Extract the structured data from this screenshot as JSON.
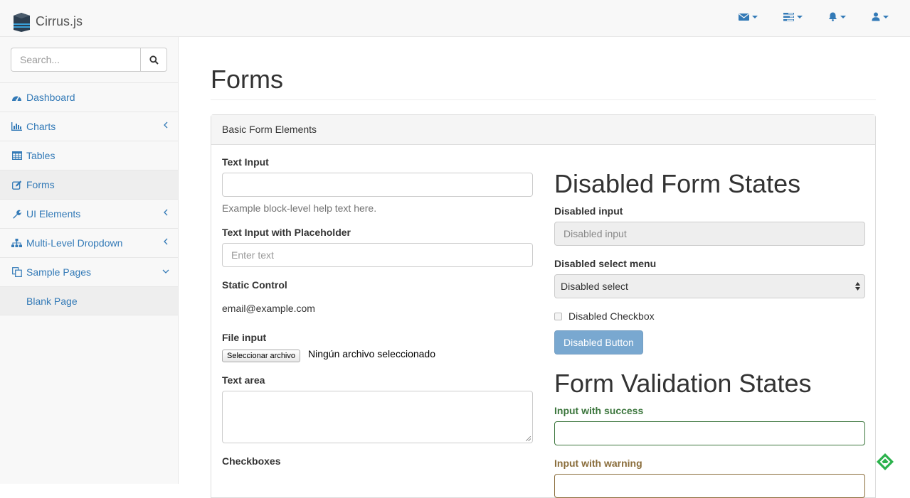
{
  "brand": {
    "name": "Cirrus.js",
    "logo_icon": "cube-logo-icon"
  },
  "navbar": {
    "items": [
      {
        "icon": "envelope-icon"
      },
      {
        "icon": "tasks-icon"
      },
      {
        "icon": "bell-icon"
      },
      {
        "icon": "user-icon"
      }
    ],
    "accent": "#337ab7"
  },
  "sidebar": {
    "search_placeholder": "Search...",
    "items": [
      {
        "label": "Dashboard",
        "icon": "dashboard-icon"
      },
      {
        "label": "Charts",
        "icon": "bar-chart-icon",
        "arrow": "chevron-left"
      },
      {
        "label": "Tables",
        "icon": "table-icon"
      },
      {
        "label": "Forms",
        "icon": "edit-icon",
        "active": true
      },
      {
        "label": "UI Elements",
        "icon": "wrench-icon",
        "arrow": "chevron-left"
      },
      {
        "label": "Multi-Level Dropdown",
        "icon": "sitemap-icon",
        "arrow": "chevron-left"
      },
      {
        "label": "Sample Pages",
        "icon": "files-icon",
        "arrow": "chevron-down"
      }
    ],
    "subitems": [
      {
        "label": "Blank Page"
      }
    ]
  },
  "main": {
    "title": "Forms",
    "panel_heading": "Basic Form Elements",
    "left": {
      "text_input_label": "Text Input",
      "text_input_value": "",
      "help_text": "Example block-level help text here.",
      "placeholder_label": "Text Input with Placeholder",
      "placeholder_text": "Enter text",
      "static_label": "Static Control",
      "static_value": "email@example.com",
      "file_label": "File input",
      "file_button": "Seleccionar archivo",
      "file_status": "Ningún archivo seleccionado",
      "textarea_label": "Text area",
      "checkboxes_label": "Checkboxes"
    },
    "right": {
      "disabled_heading": "Disabled Form States",
      "disabled_input_label": "Disabled input",
      "disabled_input_placeholder": "Disabled input",
      "disabled_select_label": "Disabled select menu",
      "disabled_select_value": "Disabled select",
      "disabled_checkbox_label": "Disabled Checkbox",
      "disabled_button": "Disabled Button",
      "validation_heading": "Form Validation States",
      "success_label": "Input with success",
      "warning_label": "Input with warning",
      "success_color": "#3c763d",
      "warning_color": "#8a6d3b"
    }
  }
}
